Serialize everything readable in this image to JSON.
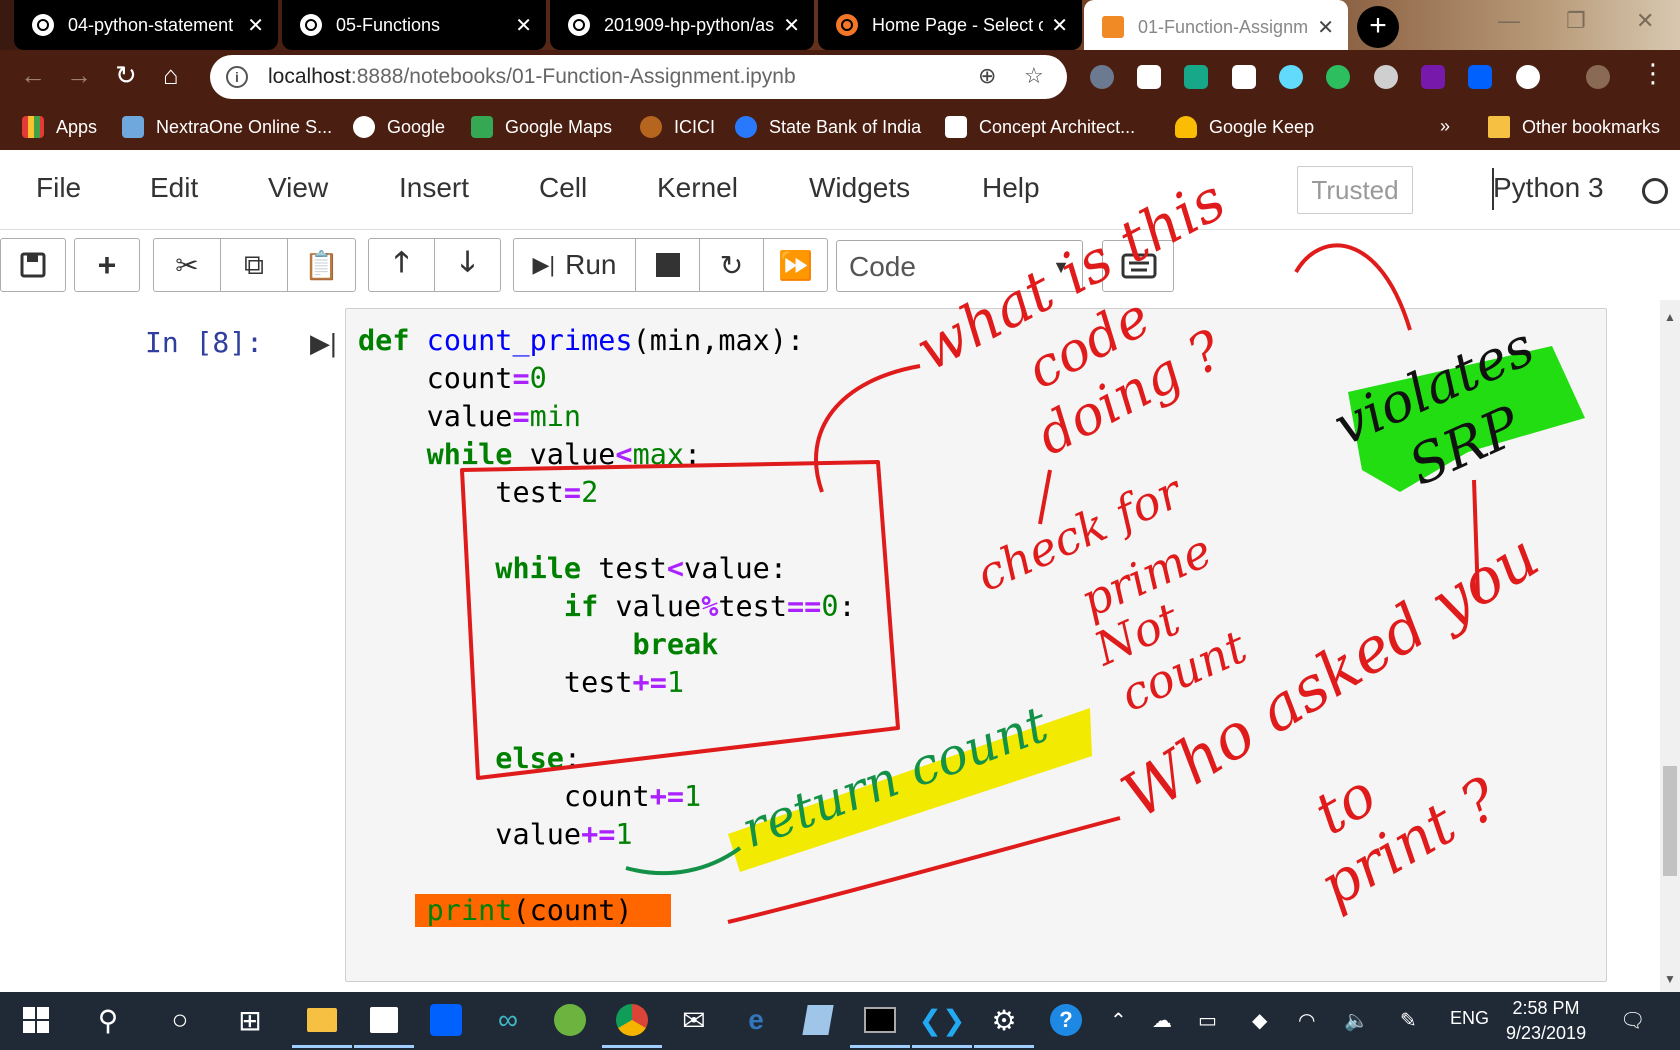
{
  "browser": {
    "tabs": [
      {
        "title": "04-python-statement",
        "active": false
      },
      {
        "title": "05-Functions",
        "active": false
      },
      {
        "title": "201909-hp-python/as",
        "active": false
      },
      {
        "title": "Home Page - Select o",
        "active": false
      },
      {
        "title": "01-Function-Assignm",
        "active": true
      }
    ],
    "address": {
      "host": "localhost",
      "path": ":8888/notebooks/01-Function-Assignment.ipynb"
    },
    "bookmarks": [
      "Apps",
      "NextraOne Online S...",
      "Google",
      "Google Maps",
      "ICICI",
      "State Bank of India",
      "Concept Architect...",
      "Google Keep"
    ],
    "bookmarks_overflow": "»",
    "other_bookmarks": "Other bookmarks"
  },
  "jupyter": {
    "menu": [
      "File",
      "Edit",
      "View",
      "Insert",
      "Cell",
      "Kernel",
      "Widgets",
      "Help"
    ],
    "trusted": "Trusted",
    "kernel": "Python 3",
    "run_label": "Run",
    "cell_type": "Code",
    "prompt": "In [8]:"
  },
  "code": {
    "l1_kw": "def",
    "l1_fn": "count_primes",
    "l1_rest": "(min,max):",
    "l2_a": "count",
    "l2_op": "=",
    "l2_num": "0",
    "l3_a": "value",
    "l3_op": "=",
    "l3_b": "min",
    "l4_kw": "while",
    "l4_a": " value",
    "l4_op": "<",
    "l4_b": "max",
    "l4_c": ":",
    "l5_a": "test",
    "l5_op": "=",
    "l5_num": "2",
    "l7_kw": "while",
    "l7_a": " test",
    "l7_op": "<",
    "l7_b": "value:",
    "l8_kw": "if",
    "l8_a": " value",
    "l8_op": "%",
    "l8_b": "test",
    "l8_op2": "==",
    "l8_num": "0",
    "l8_c": ":",
    "l9_kw": "break",
    "l10_a": "test",
    "l10_op": "+=",
    "l10_num": "1",
    "l12_kw": "else",
    "l12_c": ":",
    "l13_a": "count",
    "l13_op": "+=",
    "l13_num": "1",
    "l14_a": "value",
    "l14_op": "+=",
    "l14_num": "1",
    "l16_bi": "print",
    "l16_rest": "(count)"
  },
  "annotations": {
    "what_line1": "what is this",
    "what_line2": "code",
    "what_line3": "doing ?",
    "check_line1": "check for",
    "check_line2": "prime",
    "check_line3": "Not",
    "check_line4": "count",
    "violates_line1": "violates",
    "violates_line2": "SRP",
    "return_count": "return count",
    "who_line1": "Who asked you",
    "who_line2": "to",
    "who_line3": "print ?"
  },
  "taskbar": {
    "language": "ENG",
    "time": "2:58 PM",
    "date": "9/23/2019"
  }
}
